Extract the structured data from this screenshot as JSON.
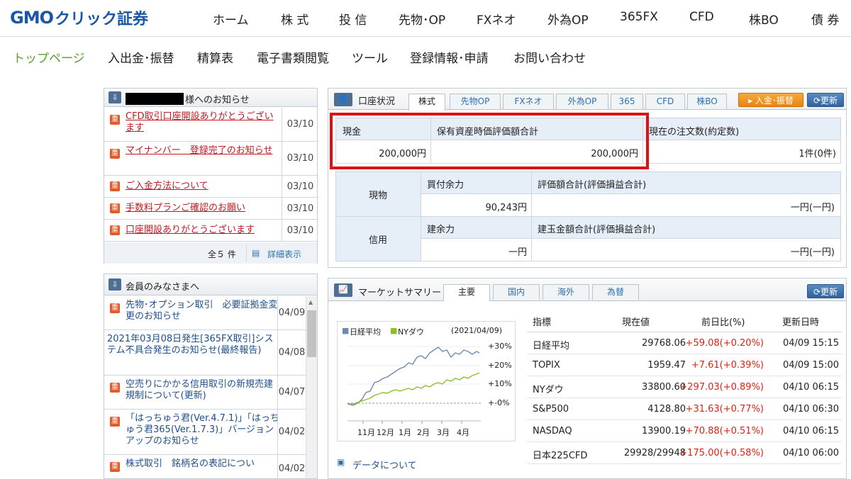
{
  "logo": {
    "part1": "GMO",
    "part2": "クリック証券"
  },
  "topnav": [
    "ホーム",
    "株 式",
    "投 信",
    "先物･OP",
    "FXネオ",
    "外為OP",
    "365FX",
    "CFD",
    "株BO",
    "債 券"
  ],
  "subnav": [
    "トップページ",
    "入出金･振替",
    "精算表",
    "電子書類閲覧",
    "ツール",
    "登録情報･申請",
    "お問い合わせ"
  ],
  "notice": {
    "title_suffix": "様へのお知らせ",
    "items": [
      {
        "text": "CFD取引口座開設ありがとうございます",
        "date": "03/10"
      },
      {
        "text": "マイナンバー　登録完了のお知らせ",
        "date": "03/10"
      },
      {
        "text": "ご入金方法について",
        "date": "03/10"
      },
      {
        "text": "手数料プランご確認のお願い",
        "date": "03/10"
      },
      {
        "text": "口座開設ありがとうございます",
        "date": "03/10"
      }
    ],
    "total": "全５ 件",
    "detail": "詳細表示"
  },
  "members": {
    "title": "会員のみなさまへ",
    "items": [
      {
        "text": "先物･オプション取引　必要証拠金変更のお知らせ",
        "date": "04/09"
      },
      {
        "text": "2021年03月08日発生[365FX取引]システム不具合発生のお知らせ(最終報告)",
        "date": "04/08"
      },
      {
        "text": "空売りにかかる信用取引の新規売建規制について(更新)",
        "date": "04/07"
      },
      {
        "text": "「はっちゅう君(Ver.4.7.1)」「はっちゅう君365(Ver.1.7.3)」バージョンアップのお知らせ",
        "date": "04/02"
      },
      {
        "text": "株式取引　銘柄名の表記につい",
        "date": "04/02"
      }
    ]
  },
  "account": {
    "title": "口座状況",
    "tabs": [
      "株式",
      "先物OP",
      "FXネオ",
      "外為OP",
      "365",
      "CFD",
      "株BO"
    ],
    "deposit_btn": "入金･振替",
    "refresh_btn": "更新",
    "cash_label": "現金",
    "holdings_label": "保有資産時価評価額合計",
    "orders_label": "現在の注文数(約定数)",
    "cash_value": "200,000円",
    "holdings_value": "200,000円",
    "orders_value": "1件(0件)",
    "genbutsu": "現物",
    "buying_power_label": "買付余力",
    "buying_power_value": "90,243円",
    "valuation_label": "評価額合計(評価損益合計)",
    "valuation_value": "一円(一円)",
    "shinyo": "信用",
    "margin_power_label": "建余力",
    "margin_power_value": "一円",
    "position_label": "建玉金額合計(評価損益合計)",
    "position_value": "一円(一円)"
  },
  "market": {
    "title": "マーケットサマリー",
    "tabs": [
      "主要",
      "国内",
      "海外",
      "為替"
    ],
    "refresh_btn": "更新",
    "legend": [
      "日経平均",
      "NYダウ"
    ],
    "date": "(2021/04/09)",
    "yticks": [
      "+30%",
      "+20%",
      "+10%",
      "+-0%"
    ],
    "xticks": [
      "11月",
      "12月",
      "1月",
      "2月",
      "3月",
      "4月"
    ],
    "data_link": "データについて",
    "headers": [
      "指標",
      "現在値",
      "前日比(%)",
      "更新日時"
    ],
    "rows": [
      [
        "日経平均",
        "29768.06",
        "+59.08(+0.20%)",
        "04/09 15:15"
      ],
      [
        "TOPIX",
        "1959.47",
        "+7.61(+0.39%)",
        "04/09 15:00"
      ],
      [
        "NYダウ",
        "33800.60",
        "+297.03(+0.89%)",
        "04/10 06:15"
      ],
      [
        "S&P500",
        "4128.80",
        "+31.63(+0.77%)",
        "04/10 06:30"
      ],
      [
        "NASDAQ",
        "13900.19",
        "+70.88(+0.51%)",
        "04/10 06:15"
      ],
      [
        "日本225CFD",
        "29928/29948",
        "+175.00(+0.58%)",
        "04/10 06:00"
      ]
    ],
    "colors": {
      "nikkei": "#6b8bb5",
      "dow": "#8bbf2a"
    }
  }
}
